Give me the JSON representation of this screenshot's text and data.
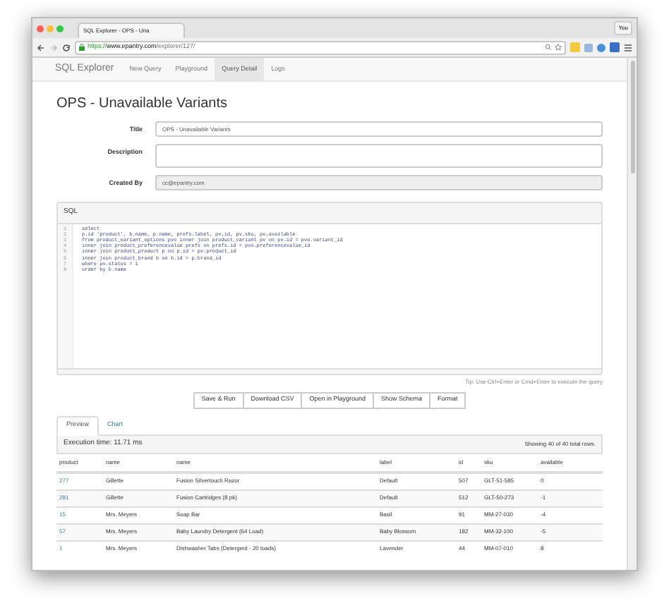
{
  "browser": {
    "tab_title": "SQL Explorer - OPS - Una",
    "profile": "You",
    "url_scheme": "https://",
    "url_host": "www.epantry.com",
    "url_path": "/explorer/127/"
  },
  "navbar": {
    "brand": "SQL Explorer",
    "items": [
      {
        "label": "New Query",
        "selected": false
      },
      {
        "label": "Playground",
        "selected": false
      },
      {
        "label": "Query Detail",
        "selected": true
      },
      {
        "label": "Logs",
        "selected": false
      }
    ]
  },
  "heading": "OPS - Unavailable Variants",
  "form": [
    {
      "label": "Title",
      "kind": "input",
      "value": "OPS - Unavailable Variants",
      "disabled": false
    },
    {
      "label": "Description",
      "kind": "textarea",
      "disabled": false
    },
    {
      "label": "Created By",
      "kind": "input",
      "value": "cc@epantry.com",
      "disabled": true
    }
  ],
  "sql": {
    "title": "SQL",
    "lines": [
      {
        "number": "1",
        "text": "select"
      },
      {
        "number": "2",
        "text": "p.id 'product', b.name, p.name, prefs.label, pv.id, pv.sku, pv.available"
      },
      {
        "number": "3",
        "text": "from product_variant_options pvo inner join product_variant pv on pv.id = pvo.variant_id"
      },
      {
        "number": "4",
        "text": "inner join product_preferencevalue prefs on prefs.id = pvo.preferencevalue_id"
      },
      {
        "number": "5",
        "text": "inner join product_product p on p.id = pv.product_id"
      },
      {
        "number": "6",
        "text": "inner join product_brand b on b.id = p.brand_id"
      },
      {
        "number": "7",
        "text": "where pv.status = 1"
      },
      {
        "number": "8",
        "text": "order by b.name"
      }
    ],
    "tip": "Tip: Use Ctrl+Enter or Cmd+Enter to execute the query"
  },
  "buttons": [
    "Save & Run",
    "Download CSV",
    "Open in Playground",
    "Show Schema",
    "Format"
  ],
  "result_tabs": [
    {
      "label": "Preview",
      "selected": true
    },
    {
      "label": "Chart",
      "selected": false
    }
  ],
  "results": {
    "execution_time": "Execution time: 11.71 ms",
    "count": "Showing 40 of 40 total rows.",
    "columns": [
      "product",
      "name",
      "name",
      "label",
      "id",
      "sku",
      "available"
    ],
    "rows": [
      [
        "277",
        "Gillette",
        "Fusion Silvertouch Razor",
        "Default",
        "507",
        "GLT-51-585",
        "0"
      ],
      [
        "281",
        "Gillette",
        "Fusion Cartridges (8 pk)",
        "Default",
        "512",
        "GLT-50-273",
        "-1"
      ],
      [
        "15",
        "Mrs. Meyers",
        "Soap Bar",
        "Basil",
        "91",
        "MM-27-030",
        "-4"
      ],
      [
        "57",
        "Mrs. Meyers",
        "Baby Laundry Detergent (64 Load)",
        "Baby Blossom",
        "182",
        "MM-32-100",
        "-5"
      ],
      [
        "1",
        "Mrs. Meyers",
        "Dishwasher Tabs (Detergent - 20 loads)",
        "Lavender",
        "44",
        "MM-07-010",
        "8"
      ]
    ]
  }
}
